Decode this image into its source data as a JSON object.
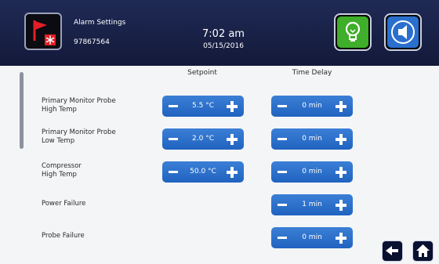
{
  "header": {
    "title": "Alarm Settings",
    "serial": "97867564",
    "time": "7:02 am",
    "date": "05/15/2016"
  },
  "columns": {
    "setpoint": "Setpoint",
    "delay": "Time Delay"
  },
  "rows": [
    {
      "label": "Primary Monitor Probe\nHigh Temp",
      "setpoint": "5.5 °C",
      "delay": "0 min"
    },
    {
      "label": "Primary Monitor Probe\nLow Temp",
      "setpoint": "2.0 °C",
      "delay": "0 min"
    },
    {
      "label": "Compressor\nHigh Temp",
      "setpoint": "50.0 °C",
      "delay": "0 min"
    },
    {
      "label": "Power Failure",
      "delay": "1 min"
    },
    {
      "label": "Probe Failure",
      "delay": "0 min"
    }
  ],
  "icons": {
    "app": "alarm-flag-icon",
    "light": "lightbulb-icon",
    "sound": "speaker-icon",
    "back": "back-arrow-icon",
    "home": "home-icon"
  },
  "colors": {
    "header": "#1b2450",
    "control": "#2a6fcd",
    "light_button": "#3fae2a",
    "sound_button": "#2a6fcd"
  }
}
